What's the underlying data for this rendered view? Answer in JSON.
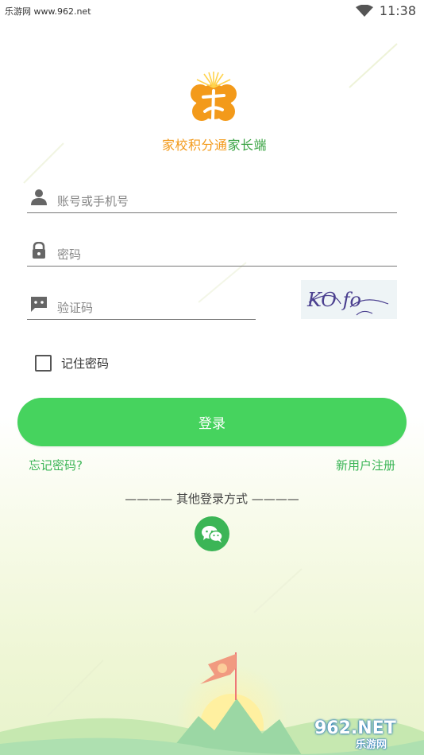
{
  "status_bar": {
    "left_text": "乐游网 www.962.net",
    "time": "11:38",
    "wifi_icon": "wifi-icon"
  },
  "app": {
    "name_part1": "家校积分通",
    "name_part2": "家长端",
    "logo_color": "#f39a1a",
    "accent_color": "#3aa343"
  },
  "form": {
    "account_placeholder": "账号或手机号",
    "password_placeholder": "密码",
    "captcha_placeholder": "验证码",
    "captcha_text": "KO fo",
    "remember_label": "记住密码",
    "login_label": "登录",
    "forgot_label": "忘记密码?",
    "register_label": "新用户注册"
  },
  "other_login": {
    "title": "———— 其他登录方式 ————",
    "wechat_icon": "wechat-icon"
  },
  "watermark": {
    "top": "962.NET",
    "bottom": "乐游网"
  },
  "colors": {
    "primary_button": "#46d35e",
    "link": "#3bb556"
  }
}
